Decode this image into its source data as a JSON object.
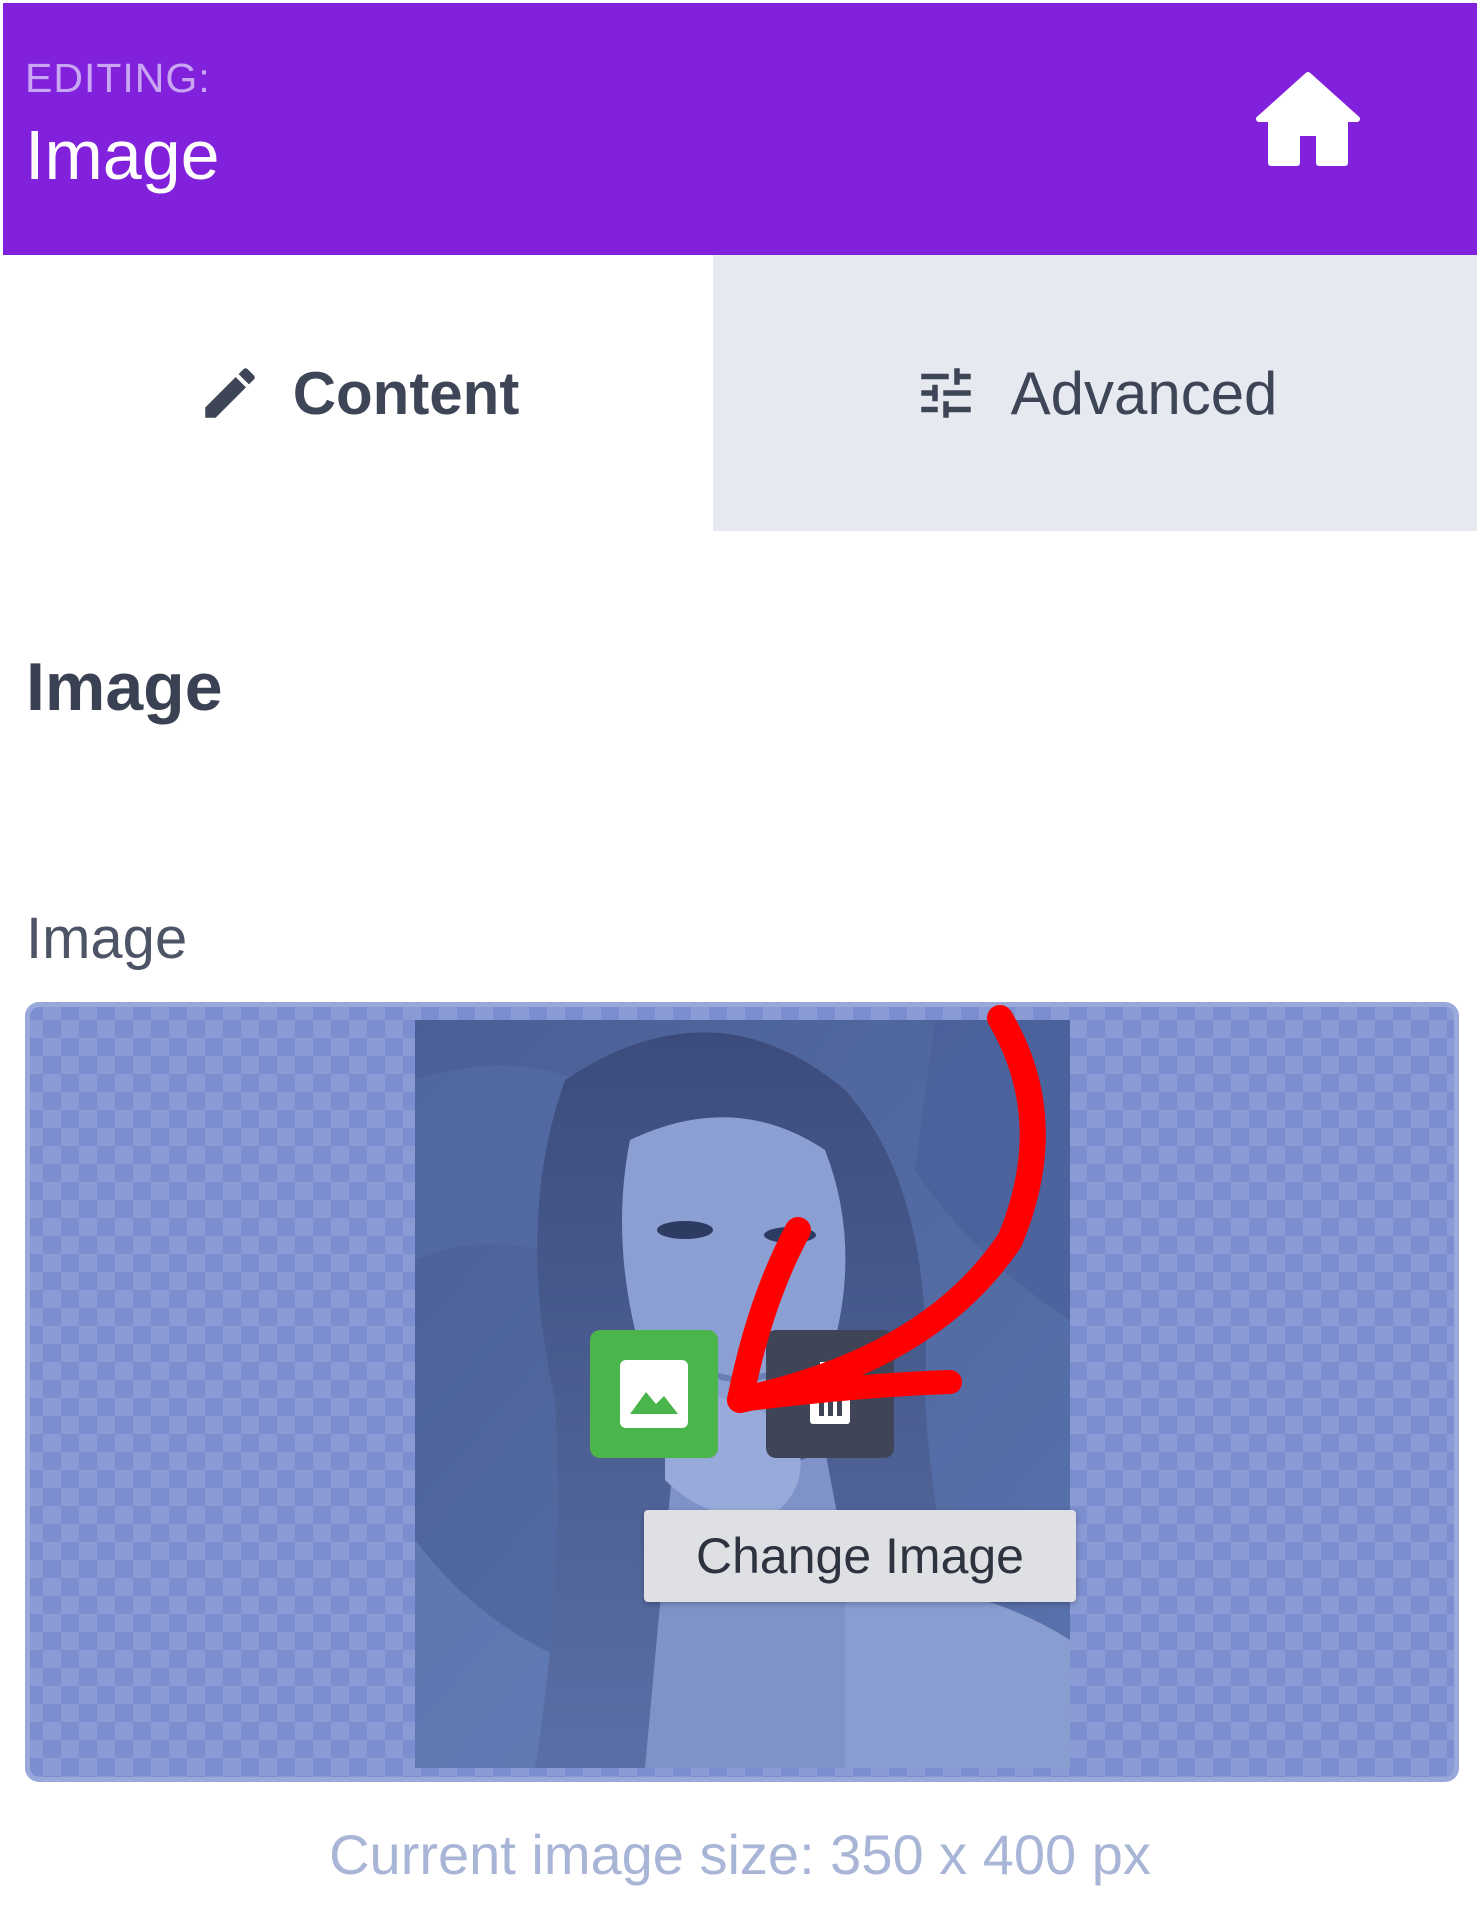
{
  "header": {
    "editing_label": "EDITING:",
    "title": "Image",
    "home_icon": "home-icon",
    "background_color": "#8121dc"
  },
  "tabs": [
    {
      "label": "Content",
      "icon": "pencil-icon",
      "active": true
    },
    {
      "label": "Advanced",
      "icon": "sliders-icon",
      "active": false
    }
  ],
  "section": {
    "heading": "Image",
    "field_label": "Image"
  },
  "image_field": {
    "change_button_icon": "image-icon",
    "remove_button_icon": "trash-icon",
    "change_button_color": "#4ab54a",
    "tooltip": "Change Image",
    "size_caption": "Current image size: 350 x 400 px"
  },
  "annotation": {
    "arrow_color": "#ff0000"
  }
}
